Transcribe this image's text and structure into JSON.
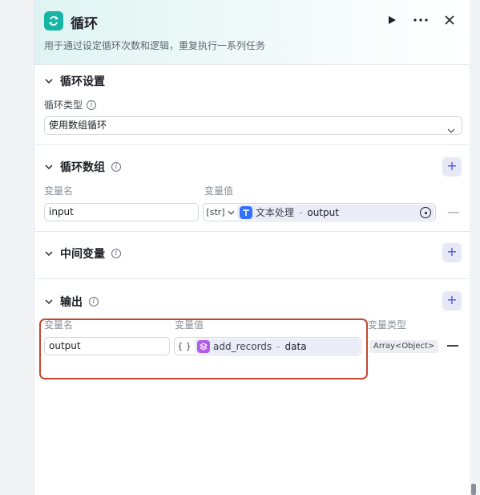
{
  "header": {
    "title": "循环",
    "description": "用于通过设定循环次数和逻辑，重复执行一系列任务",
    "icon": "loop-icon",
    "actions": [
      "run-icon",
      "more-icon",
      "close-icon"
    ]
  },
  "loop_settings": {
    "title": "循环设置",
    "type_label": "循环类型",
    "type_value": "使用数组循环"
  },
  "loop_array": {
    "title": "循环数组",
    "name_header": "变量名",
    "value_header": "变量值",
    "rows": [
      {
        "name": "input",
        "type_label": "[str]",
        "node": "文本处理",
        "variable": "output"
      }
    ]
  },
  "intermediate": {
    "title": "中间变量"
  },
  "output": {
    "title": "输出",
    "name_header": "变量名",
    "value_header": "变量值",
    "type_header": "变量类型",
    "rows": [
      {
        "name": "output",
        "type_label": "{ }",
        "node": "add_records",
        "variable": "data",
        "var_type": "Array<Object>"
      }
    ]
  },
  "colors": {
    "accent": "#4d53e8",
    "loop_icon_bg": "#17b5a6",
    "highlight": "#c6462f"
  }
}
